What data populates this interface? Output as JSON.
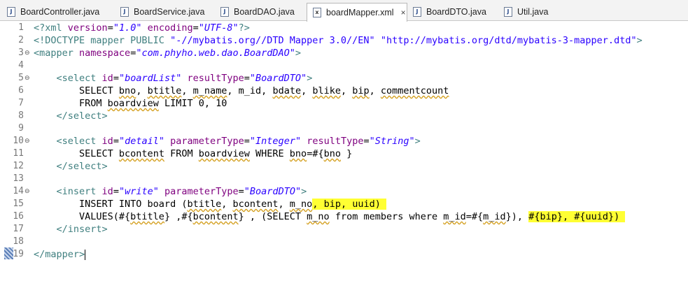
{
  "tabs": [
    {
      "label": "BoardController.java",
      "icon": "java-file-icon",
      "glyph": "J",
      "active": false
    },
    {
      "label": "BoardService.java",
      "icon": "java-file-icon",
      "glyph": "J",
      "active": false
    },
    {
      "label": "BoardDAO.java",
      "icon": "java-file-icon",
      "glyph": "J",
      "active": false
    },
    {
      "label": "boardMapper.xml",
      "icon": "xml-file-icon",
      "glyph": "x",
      "active": true,
      "close": "×"
    },
    {
      "label": "BoardDTO.java",
      "icon": "java-file-icon",
      "glyph": "J",
      "active": false
    },
    {
      "label": "Util.java",
      "icon": "java-file-icon",
      "glyph": "J",
      "active": false
    }
  ],
  "lines": [
    {
      "num": "1",
      "fold": ""
    },
    {
      "num": "2",
      "fold": ""
    },
    {
      "num": "3",
      "fold": "⊖"
    },
    {
      "num": "4",
      "fold": ""
    },
    {
      "num": "5",
      "fold": "⊖"
    },
    {
      "num": "6",
      "fold": ""
    },
    {
      "num": "7",
      "fold": ""
    },
    {
      "num": "8",
      "fold": ""
    },
    {
      "num": "9",
      "fold": ""
    },
    {
      "num": "10",
      "fold": "⊖"
    },
    {
      "num": "11",
      "fold": ""
    },
    {
      "num": "12",
      "fold": ""
    },
    {
      "num": "13",
      "fold": ""
    },
    {
      "num": "14",
      "fold": "⊖"
    },
    {
      "num": "15",
      "fold": ""
    },
    {
      "num": "16",
      "fold": ""
    },
    {
      "num": "17",
      "fold": ""
    },
    {
      "num": "18",
      "fold": ""
    },
    {
      "num": "19",
      "fold": ""
    }
  ],
  "code": {
    "l1": {
      "a": "<?xml ",
      "b": "version",
      "c": "=",
      "d": "\"1.0\"",
      "e": " encoding",
      "f": "=",
      "g": "\"UTF-8\"",
      "h": "?>"
    },
    "l2": {
      "a": "<!DOCTYPE mapper PUBLIC ",
      "b": "\"-//mybatis.org//DTD Mapper 3.0//EN\"",
      "c": " ",
      "d": "\"http://mybatis.org/dtd/mybatis-3-mapper.dtd\"",
      "e": ">"
    },
    "l3": {
      "a": "<mapper ",
      "b": "namespace",
      "c": "=",
      "d": "\"com.phyho.web.dao.BoardDAO\"",
      "e": ">"
    },
    "l5": {
      "a": "    <select ",
      "b": "id",
      "c": "=",
      "d": "\"boardList\"",
      "e": " resultType",
      "f": "=",
      "g": "\"BoardDTO\"",
      "h": ">"
    },
    "l6": {
      "a": "        SELECT ",
      "b": "bno",
      "c": ", ",
      "d": "btitle",
      "e": ", ",
      "f": "m_name",
      "g": ", m_id, ",
      "h": "bdate",
      "i": ", ",
      "j": "blike",
      "k": ", ",
      "l": "bip",
      "m": ", ",
      "n": "commentcount"
    },
    "l7": {
      "a": "        FROM ",
      "b": "boardview",
      "c": " LIMIT 0, 10"
    },
    "l8": {
      "a": "    </select>"
    },
    "l10": {
      "a": "    <select ",
      "b": "id",
      "c": "=",
      "d": "\"detail\"",
      "e": " parameterType",
      "f": "=",
      "g": "\"Integer\"",
      "h": " resultType",
      "i": "=",
      "j": "\"String\"",
      "k": ">"
    },
    "l11": {
      "a": "        SELECT ",
      "b": "bcontent",
      "c": " FROM ",
      "d": "boardview",
      "e": " WHERE ",
      "f": "bno",
      "g": "=#{",
      "h": "bno",
      "i": " }"
    },
    "l12": {
      "a": "    </select>"
    },
    "l14": {
      "a": "    <insert ",
      "b": "id",
      "c": "=",
      "d": "\"write\"",
      "e": " parameterType",
      "f": "=",
      "g": "\"BoardDTO\"",
      "h": ">"
    },
    "l15": {
      "a": "        INSERT INTO board (",
      "b": "btitle",
      "c": ", ",
      "d": "bcontent",
      "e": ", ",
      "f": "m_no",
      "g": ", bip, uuid) "
    },
    "l16": {
      "a": "        VALUES(#{",
      "b": "btitle",
      "c": "} ,#{",
      "d": "bcontent",
      "e": "} , (SELECT ",
      "f": "m_no",
      "g": " from members where ",
      "h": "m_id",
      "i": "=#{",
      "j": "m_id",
      "k": "}), ",
      "l": "#{bip}, #{uuid}) "
    },
    "l17": {
      "a": "    </insert>"
    },
    "l19": {
      "a": "</mapper>"
    }
  },
  "colors": {
    "tag": "#3f7f7f",
    "attribute": "#7f007f",
    "value": "#2a00ff",
    "highlight": "#ffff33",
    "line_number": "#787878"
  }
}
